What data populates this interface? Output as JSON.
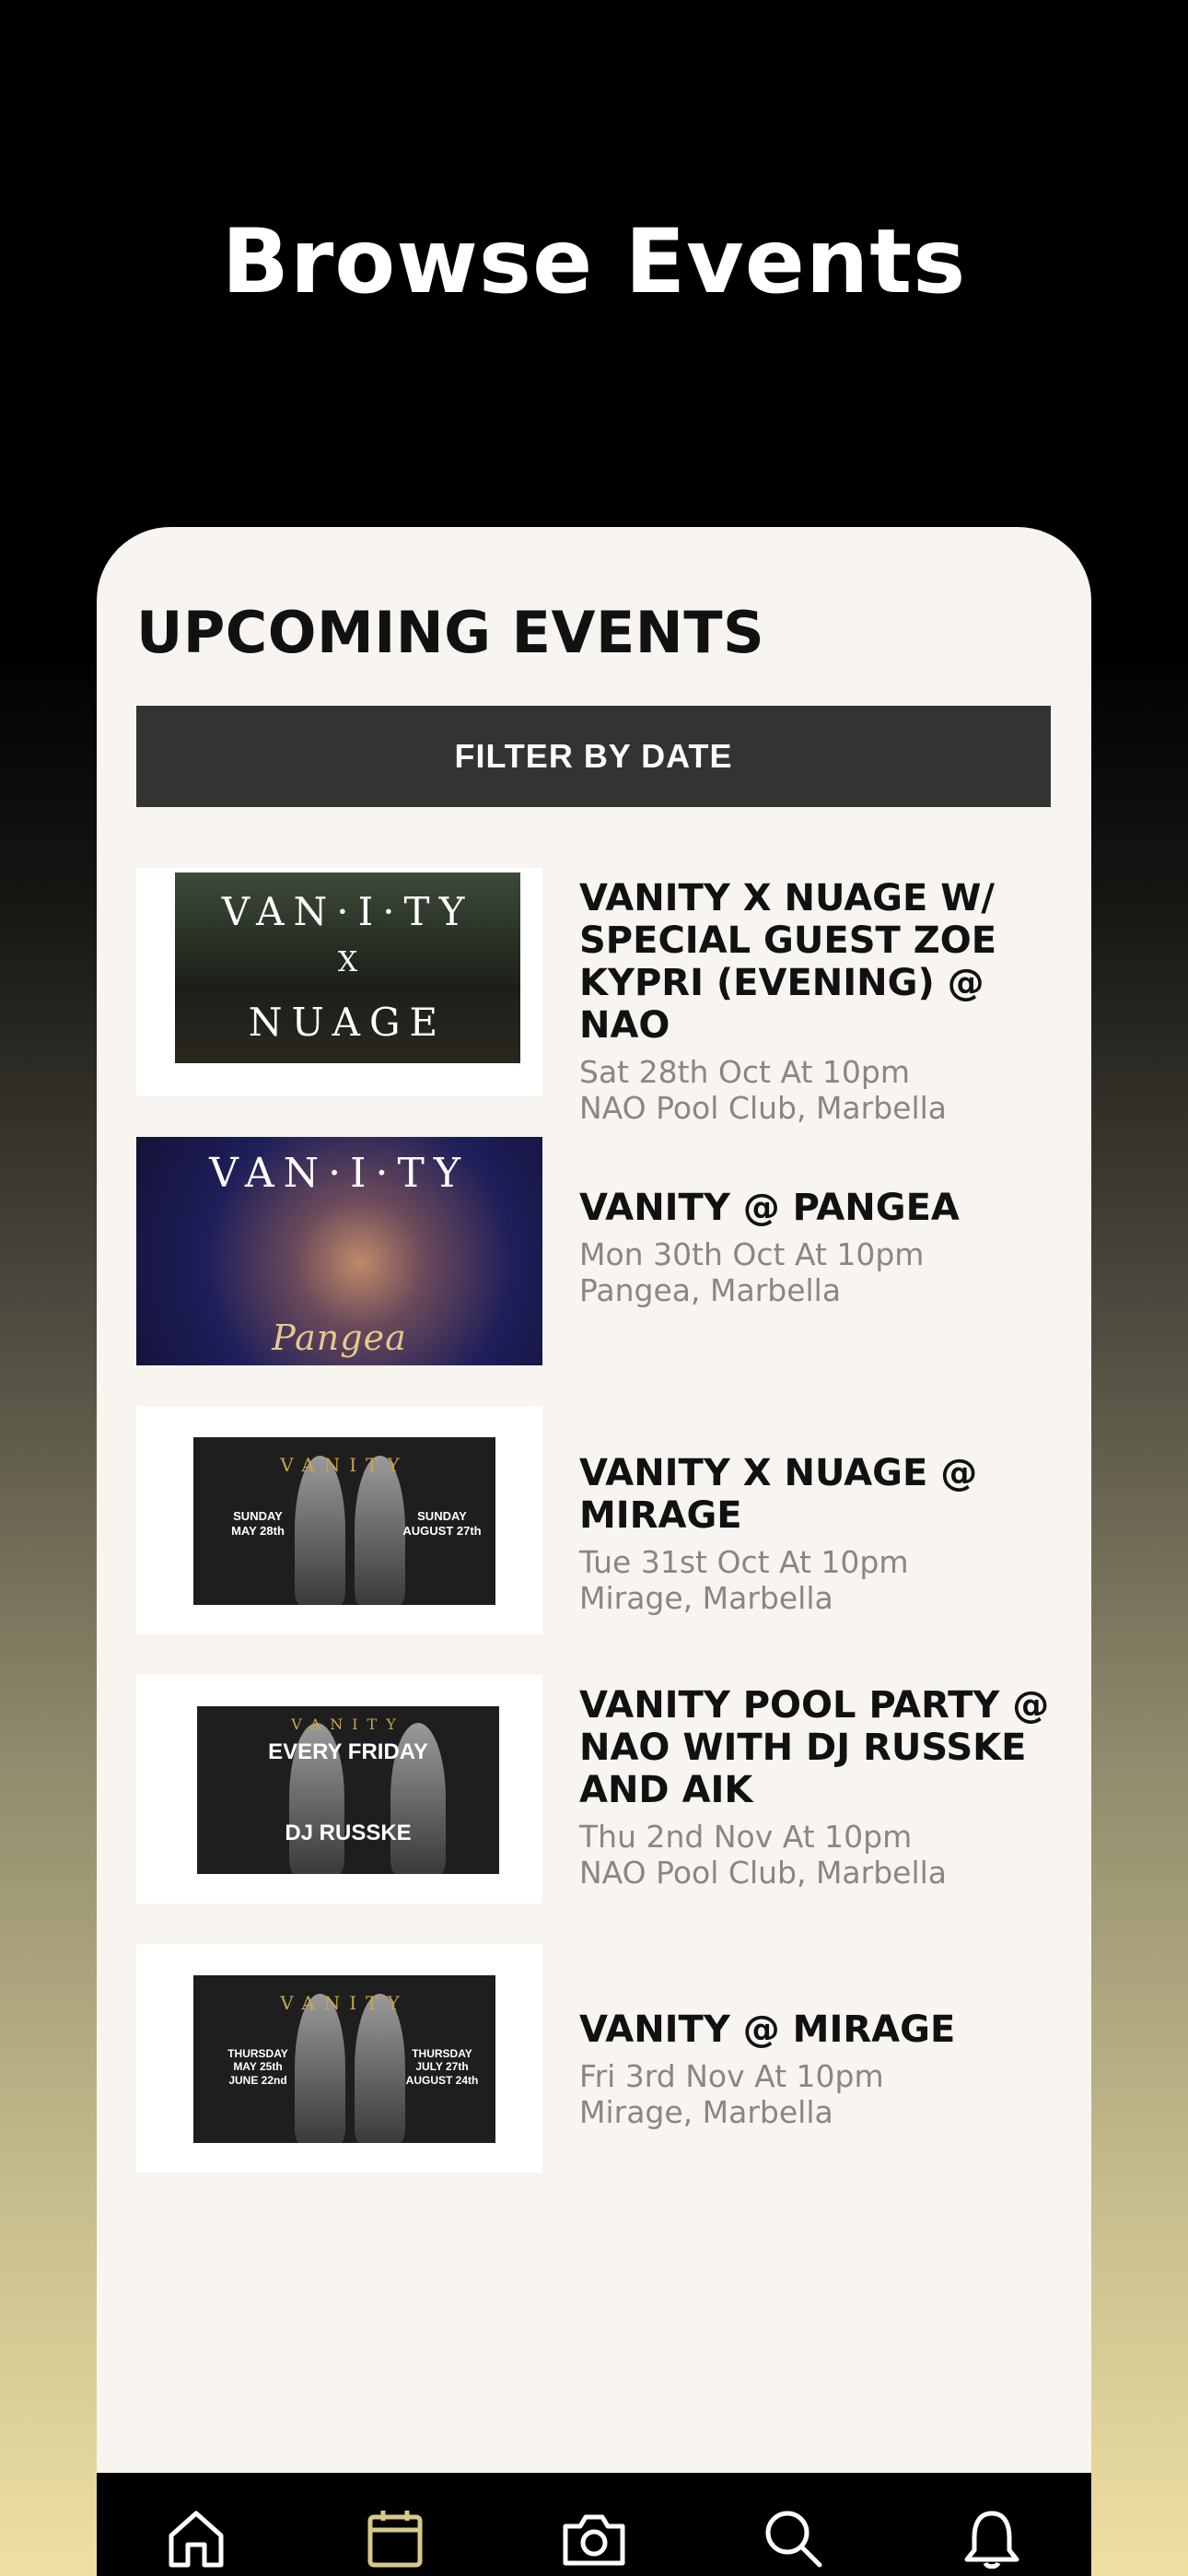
{
  "header": {
    "title": "Browse Events"
  },
  "section": {
    "title": "UPCOMING EVENTS",
    "filter_label": "FILTER BY DATE"
  },
  "events": [
    {
      "name": "VANITY X NUAGE W/ SPECIAL GUEST ZOE KYPRI (EVENING) @ NAO",
      "date": "Sat 28th Oct At 10pm",
      "venue": "NAO Pool Club, Marbella",
      "art": {
        "brand": "VAN·I·TY",
        "x": "X",
        "partner": "NUAGE"
      }
    },
    {
      "name": "VANITY @ PANGEA",
      "date": "Mon 30th Oct At 10pm",
      "venue": "Pangea, Marbella",
      "art": {
        "brand": "VAN·I·TY",
        "partner": "Pangea"
      }
    },
    {
      "name": "VANITY X NUAGE @ MIRAGE",
      "date": "Tue 31st Oct At 10pm",
      "venue": "Mirage, Marbella",
      "art": {
        "brand": "VANITY",
        "left": "SUNDAY\nMAY 28th",
        "right": "SUNDAY\nAUGUST 27th"
      }
    },
    {
      "name": "VANITY POOL PARTY @ NAO WITH DJ RUSSKE AND AIK",
      "date": "Thu 2nd Nov At 10pm",
      "venue": "NAO Pool Club, Marbella",
      "art": {
        "brand": "VANITY",
        "headline": "EVERY FRIDAY",
        "dj": "DJ RUSSKE"
      }
    },
    {
      "name": "VANITY @ MIRAGE",
      "date": "Fri 3rd Nov At 10pm",
      "venue": "Mirage, Marbella",
      "art": {
        "brand": "VANITY",
        "left": "THURSDAY\nMAY 25th\nJUNE 22nd",
        "right": "THURSDAY\nJULY 27th\nAUGUST 24th"
      }
    }
  ],
  "nav": {
    "items": [
      {
        "icon": "home-icon"
      },
      {
        "icon": "calendar-icon",
        "active": true
      },
      {
        "icon": "camera-icon"
      },
      {
        "icon": "search-icon"
      },
      {
        "icon": "bell-icon"
      }
    ],
    "active_color": "#d8c98a",
    "inactive_color": "#ffffff"
  }
}
